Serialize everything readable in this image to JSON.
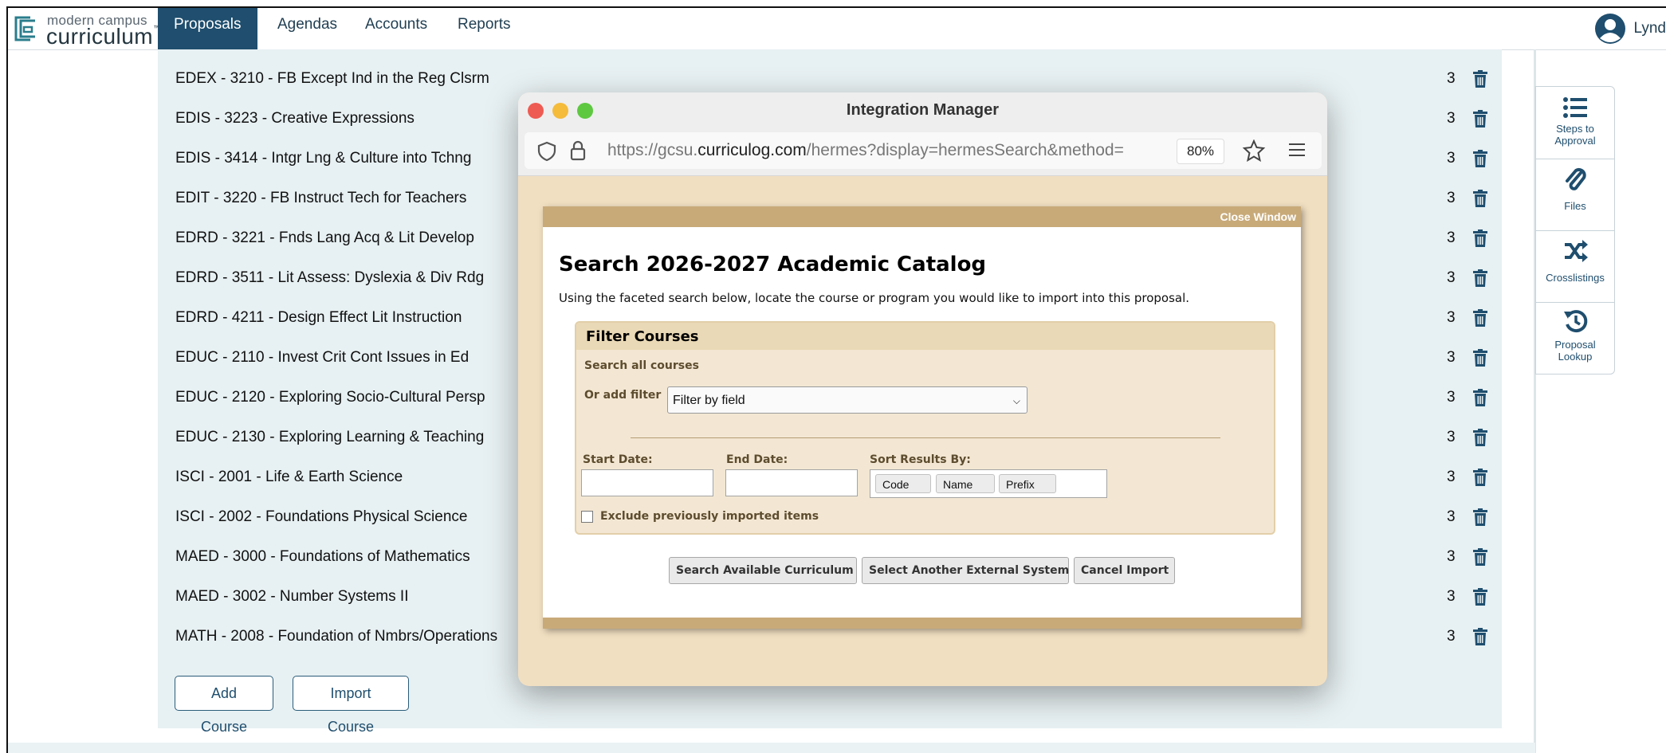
{
  "brand": {
    "line1": "modern campus",
    "line2": "curriculum",
    "tm": "™"
  },
  "nav": {
    "tabs": [
      "Proposals",
      "Agendas",
      "Accounts",
      "Reports"
    ],
    "user": "Lynd"
  },
  "courses": [
    {
      "name": "EDEX - 3210 - FB Except Ind in the Reg Clsrm",
      "credits": "3"
    },
    {
      "name": "EDIS - 3223 - Creative Expressions",
      "credits": "3"
    },
    {
      "name": "EDIS - 3414 - Intgr Lng & Culture into Tchng",
      "credits": "3"
    },
    {
      "name": "EDIT - 3220 - FB Instruct Tech for Teachers",
      "credits": "3"
    },
    {
      "name": "EDRD - 3221 - Fnds Lang Acq & Lit Develop",
      "credits": "3"
    },
    {
      "name": "EDRD - 3511 - Lit Assess: Dyslexia & Div Rdg",
      "credits": "3"
    },
    {
      "name": "EDRD - 4211 - Design Effect Lit Instruction",
      "credits": "3"
    },
    {
      "name": "EDUC - 2110 - Invest Crit Cont Issues in Ed",
      "credits": "3"
    },
    {
      "name": "EDUC - 2120 - Exploring Socio-Cultural Persp",
      "credits": "3"
    },
    {
      "name": "EDUC - 2130 - Exploring Learning & Teaching",
      "credits": "3"
    },
    {
      "name": "ISCI - 2001 - Life & Earth Science",
      "credits": "3"
    },
    {
      "name": "ISCI - 2002 - Foundations Physical Science",
      "credits": "3"
    },
    {
      "name": "MAED - 3000 - Foundations of Mathematics",
      "credits": "3"
    },
    {
      "name": "MAED - 3002 - Number Systems II",
      "credits": "3"
    },
    {
      "name": "MATH - 2008 - Foundation of Nmbrs/Operations",
      "credits": "3"
    }
  ],
  "actions": {
    "add_course": "Add Course",
    "import_course": "Import Course"
  },
  "sidetools": {
    "steps": [
      "Steps to",
      "Approval"
    ],
    "files": "Files",
    "crosslistings": "Crosslistings",
    "lookup": [
      "Proposal",
      "Lookup"
    ]
  },
  "popup": {
    "title": "Integration Manager",
    "url_prefix": "https://gcsu.",
    "url_domain": "curriculog.com",
    "url_rest": "/hermes?display=hermesSearch&method=",
    "zoom": "80%"
  },
  "dialog": {
    "close": "Close Window",
    "heading": "Search 2026-2027 Academic Catalog",
    "description": "Using the faceted search below, locate the course or program you would like to import into this proposal.",
    "filter_title": "Filter Courses",
    "search_all": "Search all courses",
    "or_add_filter": "Or add filter",
    "filter_select": "Filter by field",
    "start_date": "Start Date:",
    "end_date": "End Date:",
    "sort_by": "Sort Results By:",
    "sort_chips": [
      "Code",
      "Name",
      "Prefix"
    ],
    "exclude_label": "Exclude previously imported items",
    "buttons": [
      "Search Available Curriculum",
      "Select Another External System",
      "Cancel Import"
    ]
  },
  "colors": {
    "nav_active": "#1f4e6e",
    "panel": "#e7f0f2",
    "popup_bg": "#f1dfc1",
    "dialog_band": "#c8aa79"
  }
}
